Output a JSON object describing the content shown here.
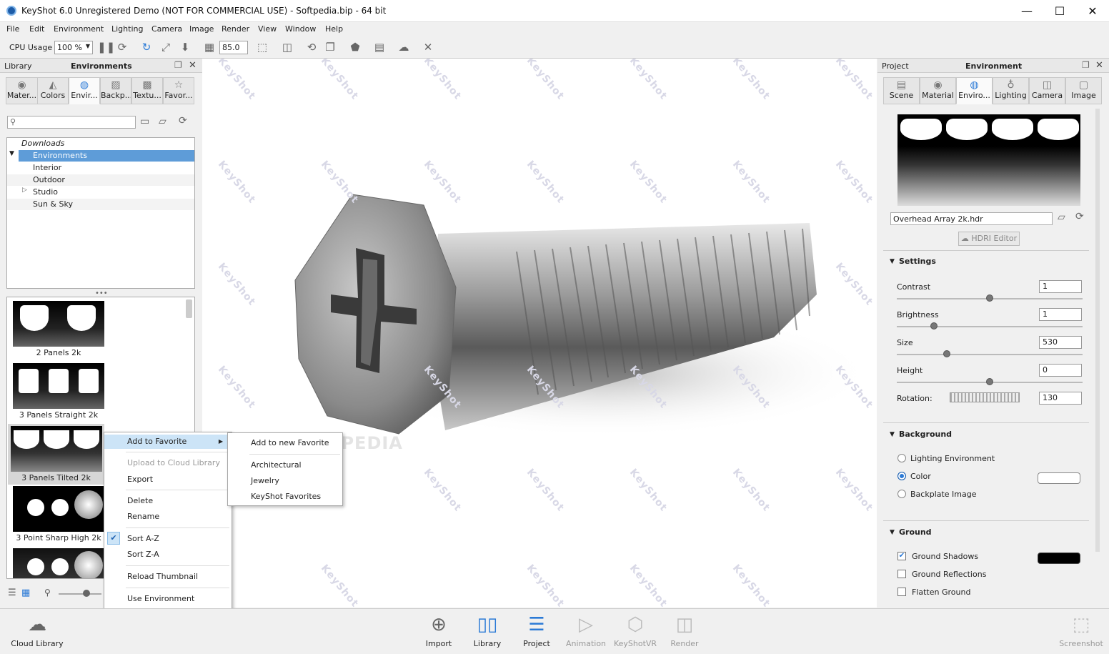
{
  "window": {
    "title": "KeyShot 6.0 Unregistered Demo (NOT FOR COMMERCIAL USE) - Softpedia.bip  - 64 bit",
    "minimize": "—",
    "maximize": "☐",
    "close": "✕"
  },
  "menu": [
    "File",
    "Edit",
    "Environment",
    "Lighting",
    "Camera",
    "Image",
    "Render",
    "View",
    "Window",
    "Help"
  ],
  "toolbar": {
    "cpu_label": "CPU Usage",
    "cpu_value": "100 %",
    "fov_value": "85.0"
  },
  "library": {
    "panel_label": "Library",
    "panel_title": "Environments",
    "tabs": [
      "Mater...",
      "Colors",
      "Envir...",
      "Backp...",
      "Textu...",
      "Favor..."
    ],
    "tree": {
      "downloads": "Downloads",
      "environments": "Environments",
      "children": [
        "Interior",
        "Outdoor",
        "Studio",
        "Sun & Sky"
      ]
    },
    "thumbs": [
      "2 Panels 2k",
      "3 Panels Straight 2k",
      "3 Panels Tilted 2k",
      "3 Point Sharp High 2k"
    ]
  },
  "context_menu": {
    "items": [
      "Add to Favorite",
      "Upload to Cloud Library",
      "Export",
      "Delete",
      "Rename",
      "Sort A-Z",
      "Sort Z-A",
      "Reload Thumbnail",
      "Use Environment"
    ],
    "submenu": [
      "Add to new Favorite",
      "Architectural",
      "Jewelry",
      "KeyShot Favorites"
    ],
    "check": "✔",
    "arrow": "▶"
  },
  "viewport": {
    "watermark": "KeyShot",
    "softpedia": "SOFTPEDIA"
  },
  "project": {
    "panel_label": "Project",
    "panel_title": "Environment",
    "tabs": [
      "Scene",
      "Material",
      "Enviro...",
      "Lighting",
      "Camera",
      "Image"
    ],
    "hdr_file": "Overhead Array 2k.hdr",
    "hdri_editor": "HDRI Editor",
    "settings": {
      "title": "Settings",
      "contrast_label": "Contrast",
      "contrast": "1",
      "contrast_pos": 0.5,
      "brightness_label": "Brightness",
      "brightness": "1",
      "brightness_pos": 0.2,
      "size_label": "Size",
      "size": "530",
      "size_pos": 0.27,
      "height_label": "Height",
      "height": "0",
      "height_pos": 0.5,
      "rotation_label": "Rotation:",
      "rotation": "130"
    },
    "background": {
      "title": "Background",
      "options": [
        "Lighting Environment",
        "Color",
        "Backplate Image"
      ],
      "selected": "Color"
    },
    "ground": {
      "title": "Ground",
      "shadows": "Ground Shadows",
      "reflections": "Ground Reflections",
      "flatten": "Flatten Ground"
    }
  },
  "bottom": {
    "cloud": "Cloud Library",
    "buttons": [
      "Import",
      "Library",
      "Project",
      "Animation",
      "KeyShotVR",
      "Render"
    ],
    "screenshot": "Screenshot"
  }
}
